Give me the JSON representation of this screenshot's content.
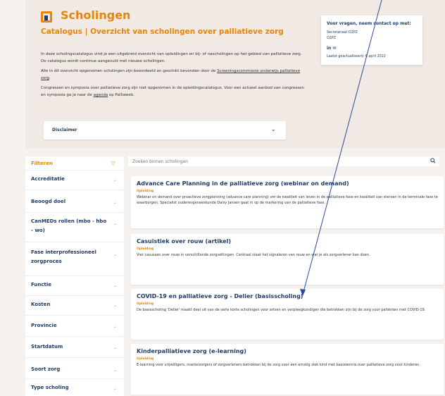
{
  "header": {
    "title": "Scholingen",
    "subtitle": "Catalogus | Overzicht van scholingen over palliatieve zorg",
    "intro_1": "In deze scholingscatalogus vind je een uitgebreid overzicht van opleidingen en bij- of nascholingen op het gebied van palliatieve zorg. De catalogus wordt continue aangevuld met nieuwe scholingen.",
    "intro_2a": "Alle in dit overzicht opgenomen scholingen zijn beoordeeld en geschikt bevonden door de ",
    "intro_2_link": "Screeningscommissie onderwijs palliatieve zorg",
    "intro_2b": ".",
    "intro_3a": "Congressen en symposia over palliatieve zorg zijn niet opgenomen in de opleidingscatalogus. Voor een actueel aanbod van congressen en symposia ga je naar de ",
    "intro_3_link": "agenda",
    "intro_3b": " op Palliaweb.",
    "disclaimer": "Disclaimer"
  },
  "contact": {
    "title": "Voor vragen, neem contact op met:",
    "name": "Secretariaat O2PZ",
    "org": "O2PZ",
    "icons": "in ✉",
    "updated": "Laatst geactualiseerd: 6 april 2022"
  },
  "sidebar": {
    "filter_label": "Filteren",
    "items": [
      "Accreditatie",
      "Beoogd doel",
      "CanMEDs rollen (mbo - hbo - wo)",
      "Fase interprofessioneel zorgproces",
      "Functie",
      "Kosten",
      "Provincie",
      "Startdatum",
      "Soort zorg",
      "Type scholing"
    ]
  },
  "search": {
    "placeholder": "Zoeken binnen scholingen"
  },
  "cards": [
    {
      "title": "Advance Care Planning in de palliatieve zorg (webinar on demand)",
      "tag": "Opleiding",
      "desc": "Webinar on demand over proactieve zorgplanning (advance care planning) om de kwaliteit van leven in de palliatieve fase en kwaliteit van sterven in de terminale fase te waarborgen. Specialist ouderengeneeskunde Daisy Jansen gaat in op de markering van de palliatieve fase."
    },
    {
      "title": "Casuïstiek over rouw (artikel)",
      "tag": "Opleiding",
      "desc": "Vier casussen over rouw in verschillende zorgsettingen. Centraal staat het signaleren van rouw en wat je als zorgverlener kan doen."
    },
    {
      "title": "COVID-19 en palliatieve zorg - Delier (basisscholing)",
      "tag": "Opleiding",
      "desc": "De basisscholing 'Delier' maakt deel uit van de serie korte scholingen voor artsen en verpleegkundigen die betrokken zijn bij de zorg voor patiënten met COVID-19."
    },
    {
      "title": "Kinderpalliatieve zorg (e-learning)",
      "tag": "Opleiding",
      "desc": "E-learning voor vrijwilligers, mantelzorgers of zorgverleners betrokken bij de zorg voor een ernstig ziek kind met basiskennis over palliatieve zorg voor kinderen."
    }
  ],
  "colors": {
    "accent": "#e8840b",
    "navy": "#1f3b66",
    "header_bg": "#f0e9e4",
    "annotation_arrow": "#2a4a9a"
  }
}
